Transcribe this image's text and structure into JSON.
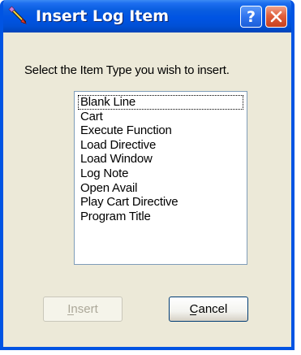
{
  "window": {
    "title": "Insert Log Item",
    "help_button_glyph": "?",
    "icon": "pencil-icon",
    "close_icon": "close-icon"
  },
  "dialog": {
    "prompt": "Select the Item Type you wish to insert.",
    "item_types": [
      "Blank Line",
      "Cart",
      "Execute Function",
      "Load Directive",
      "Load Window",
      "Log Note",
      "Open Avail",
      "Play Cart Directive",
      "Program Title"
    ],
    "focused_item": "Blank Line"
  },
  "buttons": {
    "insert_label": "Insert",
    "insert_enabled": false,
    "cancel_label": "Cancel"
  },
  "colors": {
    "titlebar": "#0054e3",
    "dialog_background": "#ece9d8",
    "close_button": "#e0603c",
    "disabled_text": "#aca899"
  }
}
